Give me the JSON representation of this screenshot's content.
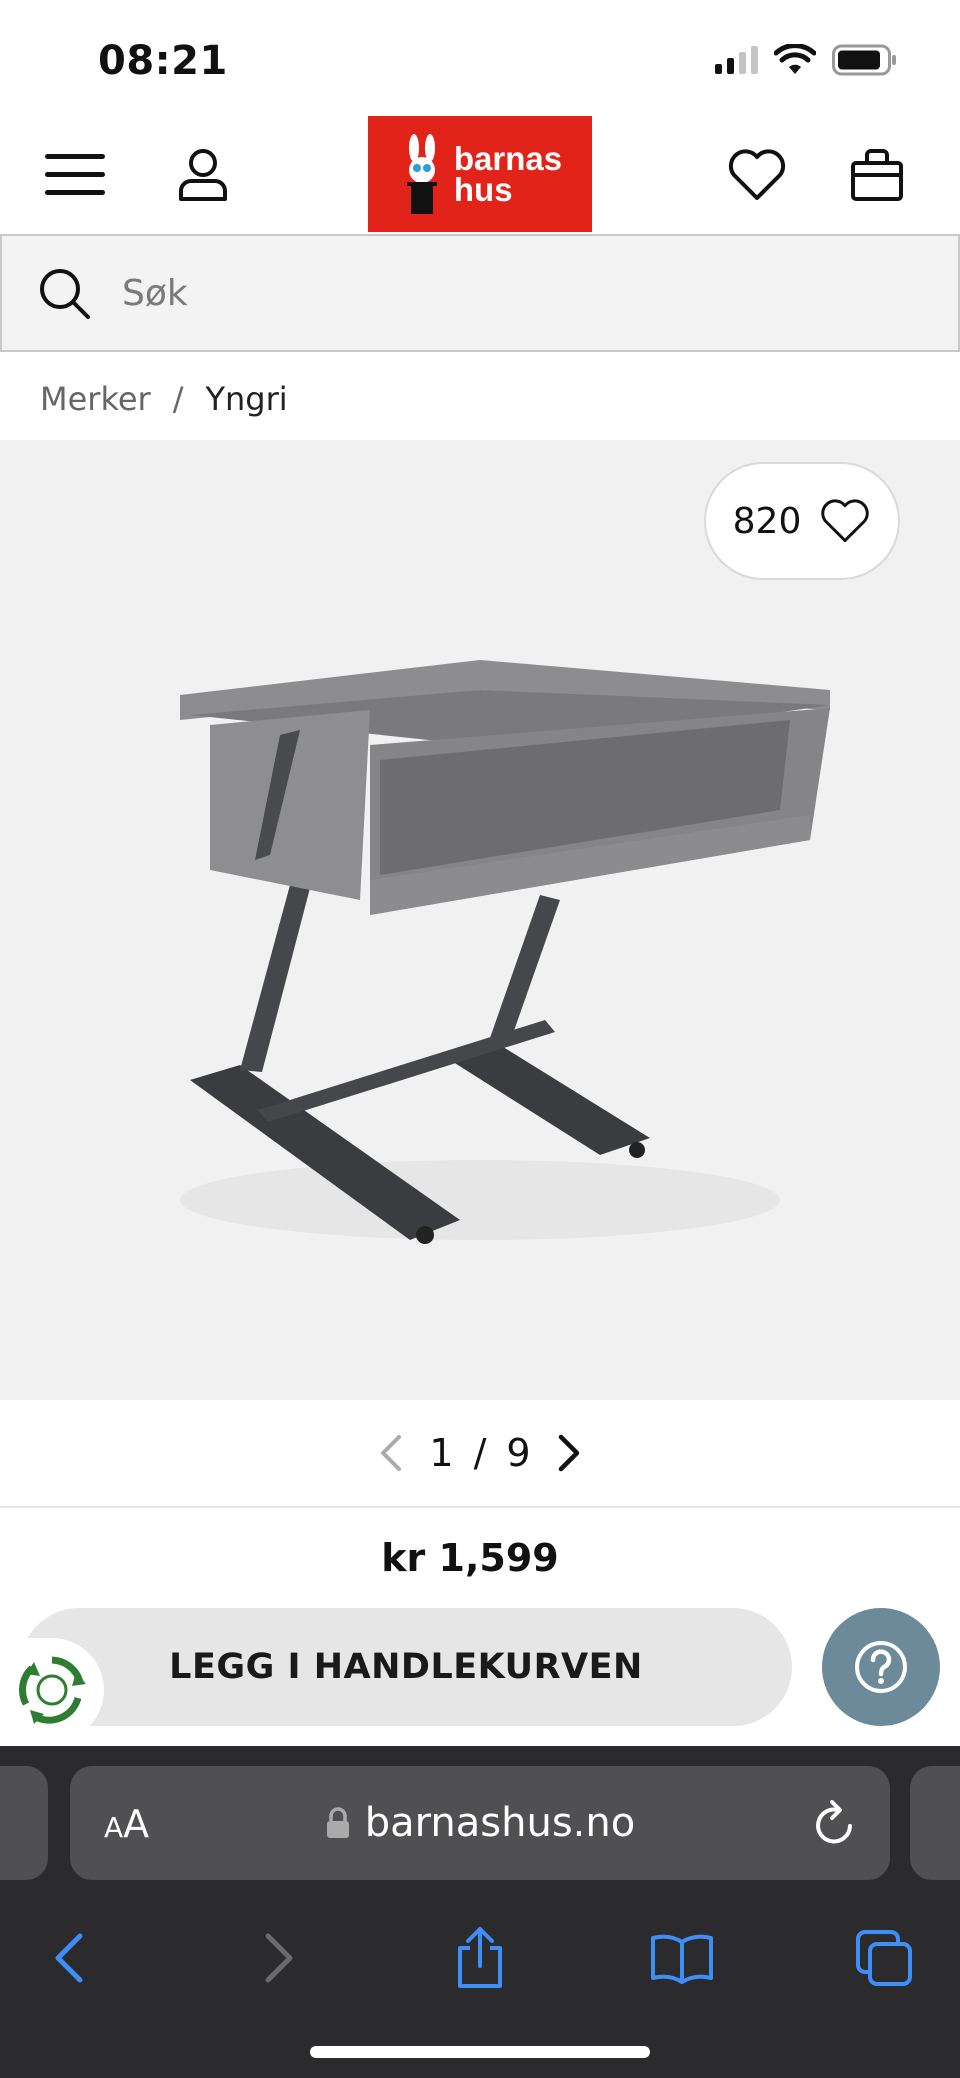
{
  "status_bar": {
    "time": "08:21"
  },
  "header": {
    "logo_line1": "barnas",
    "logo_line2": "hus",
    "brand_color": "#e2231a",
    "icons": [
      "menu-icon",
      "account-icon",
      "heart-icon",
      "bag-icon"
    ]
  },
  "search": {
    "placeholder": "Søk"
  },
  "breadcrumb": {
    "items": [
      "Merker",
      "Yngri"
    ],
    "separator": "/"
  },
  "gallery": {
    "favorites_count": "820",
    "current": "1",
    "separator": "/",
    "total": "9",
    "background": "#f1f1f1"
  },
  "product": {
    "price": "kr 1,599",
    "add_to_cart_label": "LEGG I HANDLEKURVEN",
    "help_color": "#6c8a99"
  },
  "browser": {
    "aa_label_small": "A",
    "aa_label_big": "A",
    "url": "barnashus.no",
    "accent": "#3d8ef7"
  }
}
